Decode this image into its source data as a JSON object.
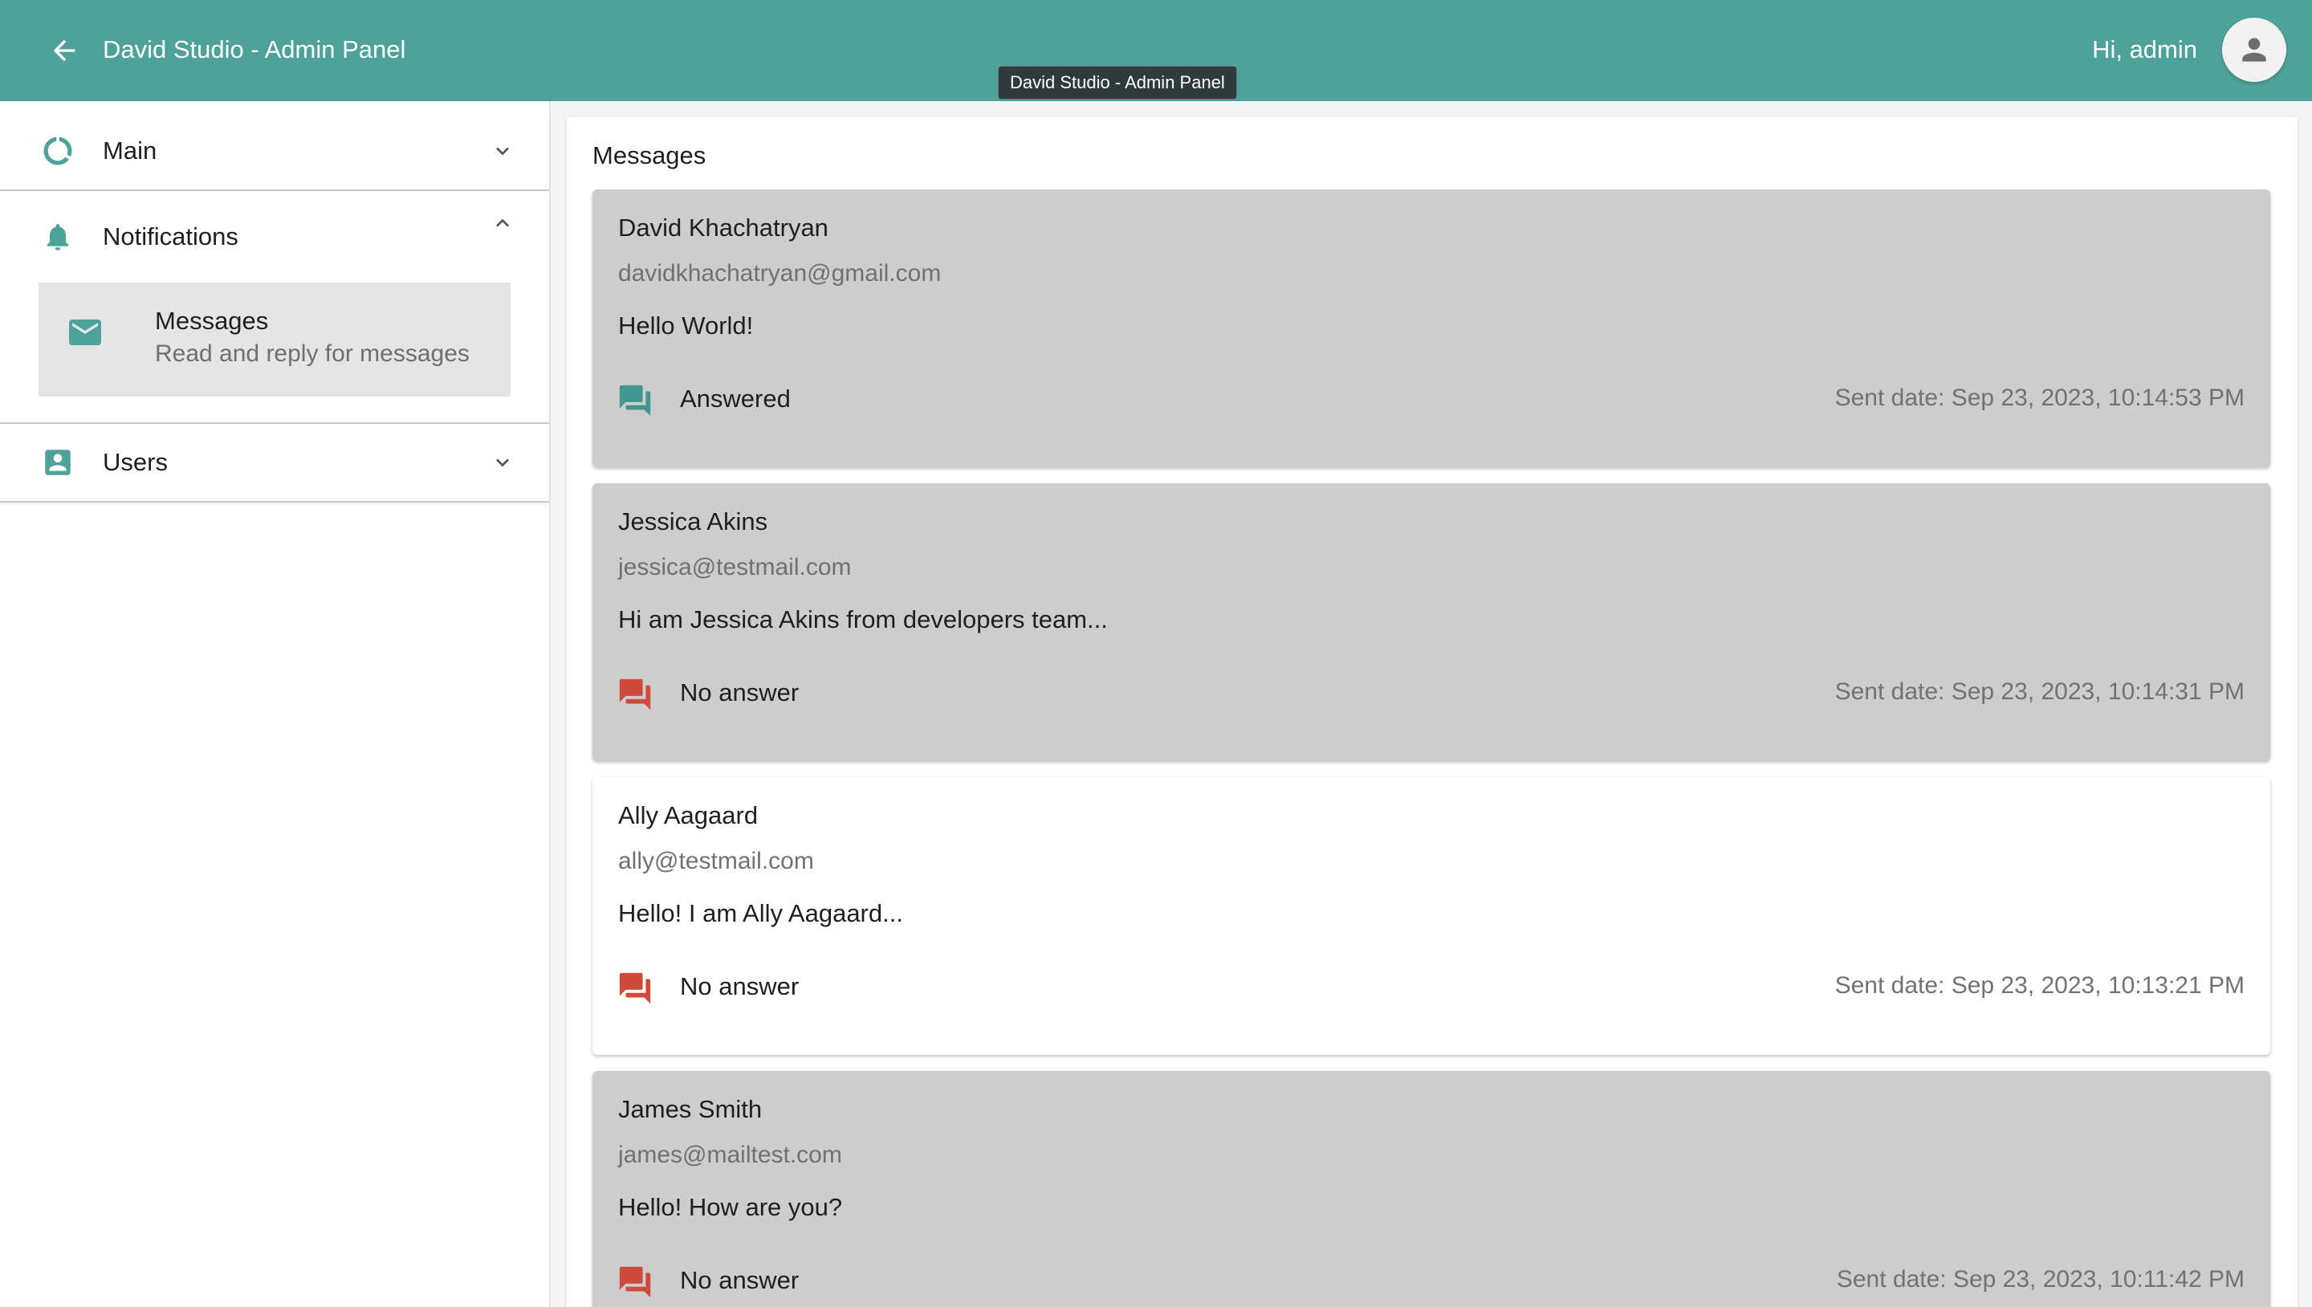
{
  "header": {
    "title": "David Studio - Admin Panel",
    "greeting": "Hi, admin",
    "tooltip": "David Studio - Admin Panel"
  },
  "sidebar": {
    "sections": [
      {
        "label": "Main",
        "icon": "donut-chart-icon",
        "expanded": false
      },
      {
        "label": "Notifications",
        "icon": "bell-icon",
        "expanded": true,
        "items": [
          {
            "title": "Messages",
            "description": "Read and reply for messages",
            "icon": "mail-icon",
            "selected": true
          }
        ]
      },
      {
        "label": "Users",
        "icon": "account-box-icon",
        "expanded": false
      }
    ]
  },
  "main": {
    "title": "Messages",
    "messages": [
      {
        "name": "David Khachatryan",
        "email": "davidkhachatryan@gmail.com",
        "text": "Hello World!",
        "status": "Answered",
        "date": "Sent date: Sep 23, 2023, 10:14:53 PM"
      },
      {
        "name": "Jessica Akins",
        "email": "jessica@testmail.com",
        "text": "Hi am Jessica Akins from developers team...",
        "status": "No answer",
        "date": "Sent date: Sep 23, 2023, 10:14:31 PM"
      },
      {
        "name": "Ally Aagaard",
        "email": "ally@testmail.com",
        "text": "Hello! I am Ally Aagaard...",
        "status": "No answer",
        "date": "Sent date: Sep 23, 2023, 10:13:21 PM"
      },
      {
        "name": "James Smith",
        "email": "james@mailtest.com",
        "text": "Hello! How are you?",
        "status": "No answer",
        "date": "Sent date: Sep 23, 2023, 10:11:42 PM"
      }
    ]
  },
  "colors": {
    "primary": "#4ea29a",
    "answered": "#3f978f",
    "no_answer": "#cf4a3d",
    "card_grey": "#cdcdcd"
  }
}
